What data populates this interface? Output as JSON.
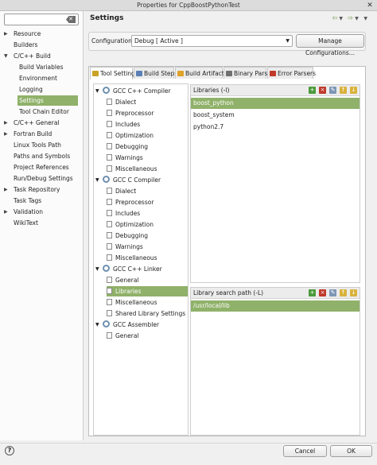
{
  "window": {
    "title": "Properties for CppBoostPythonTest"
  },
  "sidebar": {
    "filter_placeholder": "",
    "items": [
      {
        "label": "Resource",
        "expandable": true
      },
      {
        "label": "Builders"
      },
      {
        "label": "C/C++ Build",
        "expandable": true,
        "expanded": true
      },
      {
        "label": "Build Variables"
      },
      {
        "label": "Environment"
      },
      {
        "label": "Logging"
      },
      {
        "label": "Settings",
        "selected": true
      },
      {
        "label": "Tool Chain Editor"
      },
      {
        "label": "C/C++ General",
        "expandable": true
      },
      {
        "label": "Fortran Build",
        "expandable": true
      },
      {
        "label": "Linux Tools Path"
      },
      {
        "label": "Paths and Symbols"
      },
      {
        "label": "Project References"
      },
      {
        "label": "Run/Debug Settings"
      },
      {
        "label": "Task Repository",
        "expandable": true
      },
      {
        "label": "Task Tags"
      },
      {
        "label": "Validation",
        "expandable": true
      },
      {
        "label": "WikiText"
      }
    ]
  },
  "main": {
    "title": "Settings",
    "configuration_label": "Configuration:",
    "configuration_value": "Debug  [ Active ]",
    "manage_button": "Manage Configurations...",
    "tabs": [
      {
        "label": "Tool Settings",
        "active": true,
        "icon_color": "#c9a227"
      },
      {
        "label": "Build Steps",
        "icon_color": "#5a7fb5"
      },
      {
        "label": "Build Artifact",
        "icon_color": "#e0a32a"
      },
      {
        "label": "Binary Parsers",
        "icon_color": "#707070"
      },
      {
        "label": "Error Parsers",
        "icon_color": "#c0392b"
      }
    ],
    "tool_tree": [
      {
        "label": "GCC C++ Compiler",
        "group": true
      },
      {
        "label": "Dialect"
      },
      {
        "label": "Preprocessor"
      },
      {
        "label": "Includes"
      },
      {
        "label": "Optimization"
      },
      {
        "label": "Debugging"
      },
      {
        "label": "Warnings"
      },
      {
        "label": "Miscellaneous"
      },
      {
        "label": "GCC C Compiler",
        "group": true
      },
      {
        "label": "Dialect"
      },
      {
        "label": "Preprocessor"
      },
      {
        "label": "Includes"
      },
      {
        "label": "Optimization"
      },
      {
        "label": "Debugging"
      },
      {
        "label": "Warnings"
      },
      {
        "label": "Miscellaneous"
      },
      {
        "label": "GCC C++ Linker",
        "group": true
      },
      {
        "label": "General"
      },
      {
        "label": "Libraries",
        "selected": true
      },
      {
        "label": "Miscellaneous"
      },
      {
        "label": "Shared Library Settings"
      },
      {
        "label": "GCC Assembler",
        "group": true
      },
      {
        "label": "General"
      }
    ],
    "libraries": {
      "header": "Libraries (-l)",
      "items": [
        "boost_python",
        "boost_system",
        "python2.7"
      ]
    },
    "library_paths": {
      "header": "Library search path (-L)",
      "items": [
        "/usr/local/lib"
      ]
    }
  },
  "footer": {
    "help_icon": "?",
    "cancel_label": "Cancel",
    "ok_label": "OK"
  },
  "colors": {
    "selection": "#8fb169"
  }
}
